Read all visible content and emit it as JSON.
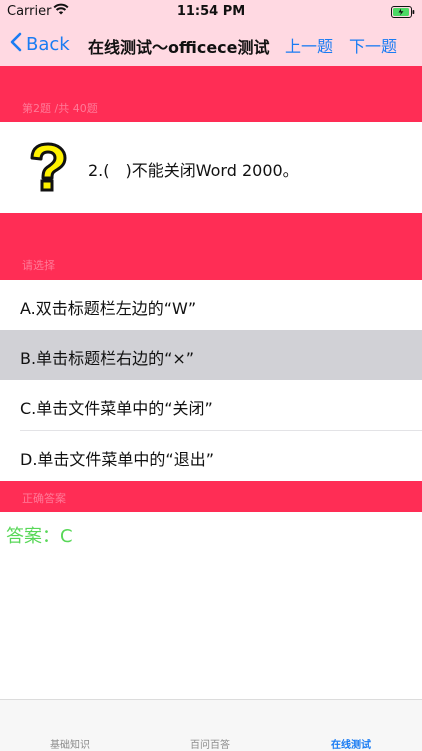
{
  "status": {
    "carrier": "Carrier",
    "time": "11:54 PM"
  },
  "nav": {
    "back_label": "Back",
    "title": "在线测试～officece测试",
    "prev_label": "上一题",
    "next_label": "下一题"
  },
  "question": {
    "header": "第2题 /共 40题",
    "text": "2.(　)不能关闭Word 2000。"
  },
  "options_header": "请选择",
  "options": [
    {
      "label": "A.双击标题栏左边的“W”",
      "selected": false
    },
    {
      "label": "B.单击标题栏右边的“×”",
      "selected": true
    },
    {
      "label": "C.单击文件菜单中的“关闭”",
      "selected": false
    },
    {
      "label": "D.单击文件菜单中的“退出”",
      "selected": false
    }
  ],
  "answer_header": "正确答案",
  "answer": "答案：C",
  "tabs": [
    {
      "label": "基础知识",
      "active": false
    },
    {
      "label": "百问百答",
      "active": false
    },
    {
      "label": "在线测试",
      "active": true
    }
  ],
  "colors": {
    "header_bg": "#ffd9e2",
    "section_bg": "#ff2d55",
    "accent": "#1a7cf3",
    "answer": "#58d758",
    "selected_row": "#d1d1d6"
  }
}
